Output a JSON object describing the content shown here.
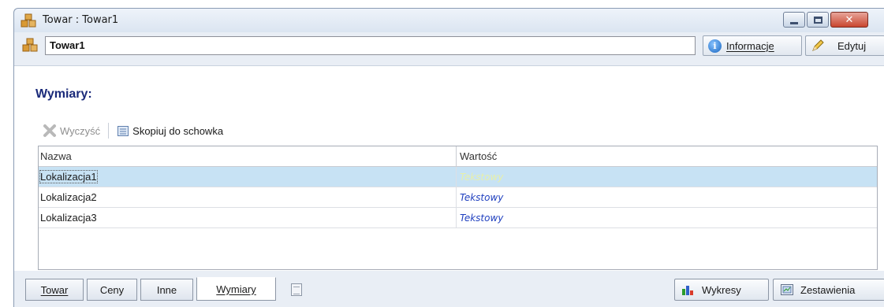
{
  "window": {
    "title": "Towar : Towar1",
    "controls": {
      "minimize": "minimize",
      "maximize": "maximize",
      "close": "close"
    }
  },
  "header": {
    "name_value": "Towar1",
    "info_button": "Informacje",
    "edit_button": "Edytuj"
  },
  "section": {
    "title": "Wymiary:"
  },
  "toolbar": {
    "clear_label": "Wyczyść",
    "copy_label": "Skopiuj do schowka"
  },
  "grid": {
    "columns": [
      "Nazwa",
      "Wartość"
    ],
    "rows": [
      {
        "name": "Lokalizacja1",
        "value": "Tekstowy",
        "selected": true
      },
      {
        "name": "Lokalizacja2",
        "value": "Tekstowy",
        "selected": false
      },
      {
        "name": "Lokalizacja3",
        "value": "Tekstowy",
        "selected": false
      }
    ]
  },
  "tabs": [
    {
      "label": "Towar",
      "active": false
    },
    {
      "label": "Ceny",
      "active": false
    },
    {
      "label": "Inne",
      "active": false
    },
    {
      "label": "Wymiary",
      "active": true
    }
  ],
  "bottom_buttons": {
    "charts": "Wykresy",
    "reports": "Zestawienia"
  },
  "colors": {
    "section_title": "#1a2a7a",
    "selected_row": "#c7e2f4",
    "value_text": "#1f3fbf"
  }
}
